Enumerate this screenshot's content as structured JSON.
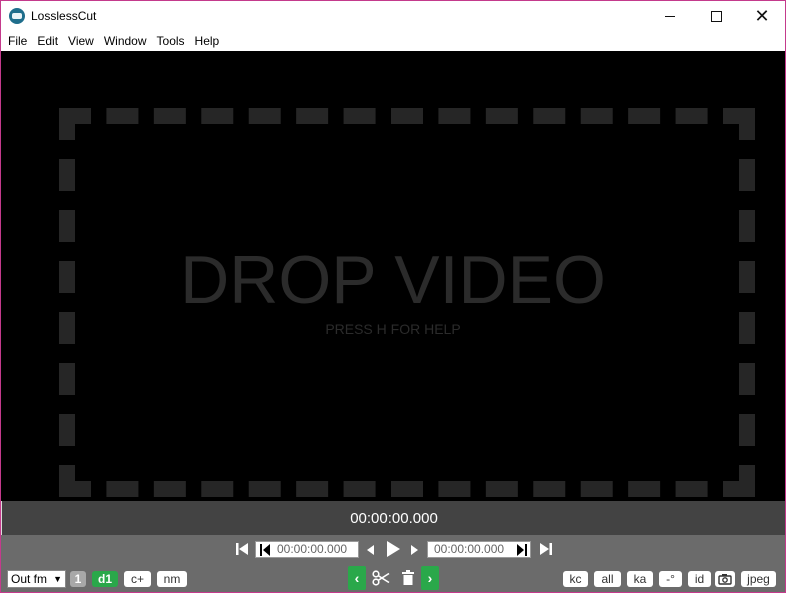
{
  "window": {
    "title": "LosslessCut",
    "minimize_icon": "minimize-icon",
    "maximize_icon": "maximize-icon",
    "close_icon": "close-icon"
  },
  "menu": [
    "File",
    "Edit",
    "View",
    "Window",
    "Tools",
    "Help"
  ],
  "drop_zone": {
    "title": "DROP VIDEO",
    "subtitle": "PRESS H FOR HELP"
  },
  "player": {
    "current_time": "00:00:00.000",
    "cut_start_time": "00:00:00.000",
    "cut_end_time": "00:00:00.000"
  },
  "left_controls": {
    "output_format": "Out fm",
    "segment_count": "1",
    "duration_toggle": "d1",
    "cut_mode": "c+",
    "naming": "nm"
  },
  "right_controls": {
    "keyframe_cut": "kc",
    "tracks": "all",
    "keep_audio": "ka",
    "rotation": "-°",
    "id": "id",
    "capture_format": "jpeg"
  },
  "colors": {
    "accent_green": "#2aa84a",
    "titlebar_border": "#c43a8c"
  }
}
